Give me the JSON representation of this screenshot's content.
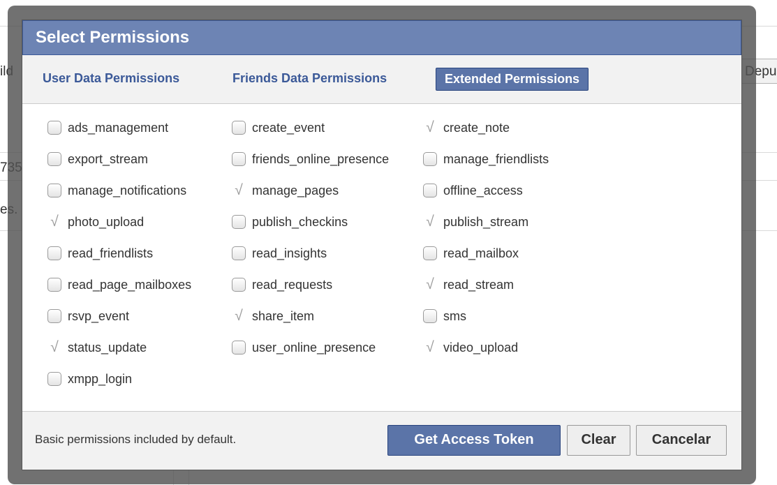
{
  "background": {
    "fragments": [
      "ild",
      "Depu",
      "735",
      "es."
    ]
  },
  "dialog": {
    "title": "Select Permissions",
    "tabs": [
      {
        "label": "User Data Permissions",
        "active": false
      },
      {
        "label": "Friends Data Permissions",
        "active": false
      },
      {
        "label": "Extended Permissions",
        "active": true
      }
    ],
    "permissions": [
      {
        "name": "ads_management",
        "checked": false
      },
      {
        "name": "create_event",
        "checked": false
      },
      {
        "name": "create_note",
        "checked": true
      },
      {
        "name": "export_stream",
        "checked": false
      },
      {
        "name": "friends_online_presence",
        "checked": false
      },
      {
        "name": "manage_friendlists",
        "checked": false
      },
      {
        "name": "manage_notifications",
        "checked": false
      },
      {
        "name": "manage_pages",
        "checked": true
      },
      {
        "name": "offline_access",
        "checked": false
      },
      {
        "name": "photo_upload",
        "checked": true
      },
      {
        "name": "publish_checkins",
        "checked": false
      },
      {
        "name": "publish_stream",
        "checked": true
      },
      {
        "name": "read_friendlists",
        "checked": false
      },
      {
        "name": "read_insights",
        "checked": false
      },
      {
        "name": "read_mailbox",
        "checked": false
      },
      {
        "name": "read_page_mailboxes",
        "checked": false
      },
      {
        "name": "read_requests",
        "checked": false
      },
      {
        "name": "read_stream",
        "checked": true
      },
      {
        "name": "rsvp_event",
        "checked": false
      },
      {
        "name": "share_item",
        "checked": true
      },
      {
        "name": "sms",
        "checked": false
      },
      {
        "name": "status_update",
        "checked": true
      },
      {
        "name": "user_online_presence",
        "checked": false
      },
      {
        "name": "video_upload",
        "checked": true
      },
      {
        "name": "xmpp_login",
        "checked": false
      }
    ],
    "footer": {
      "note": "Basic permissions included by default.",
      "get_token_label": "Get Access Token",
      "clear_label": "Clear",
      "cancel_label": "Cancelar"
    }
  },
  "colors": {
    "header_bg": "#6d84b4",
    "primary_button": "#5b74a8",
    "link_blue": "#3b5998",
    "checked_mark": "#9c9c9c"
  }
}
